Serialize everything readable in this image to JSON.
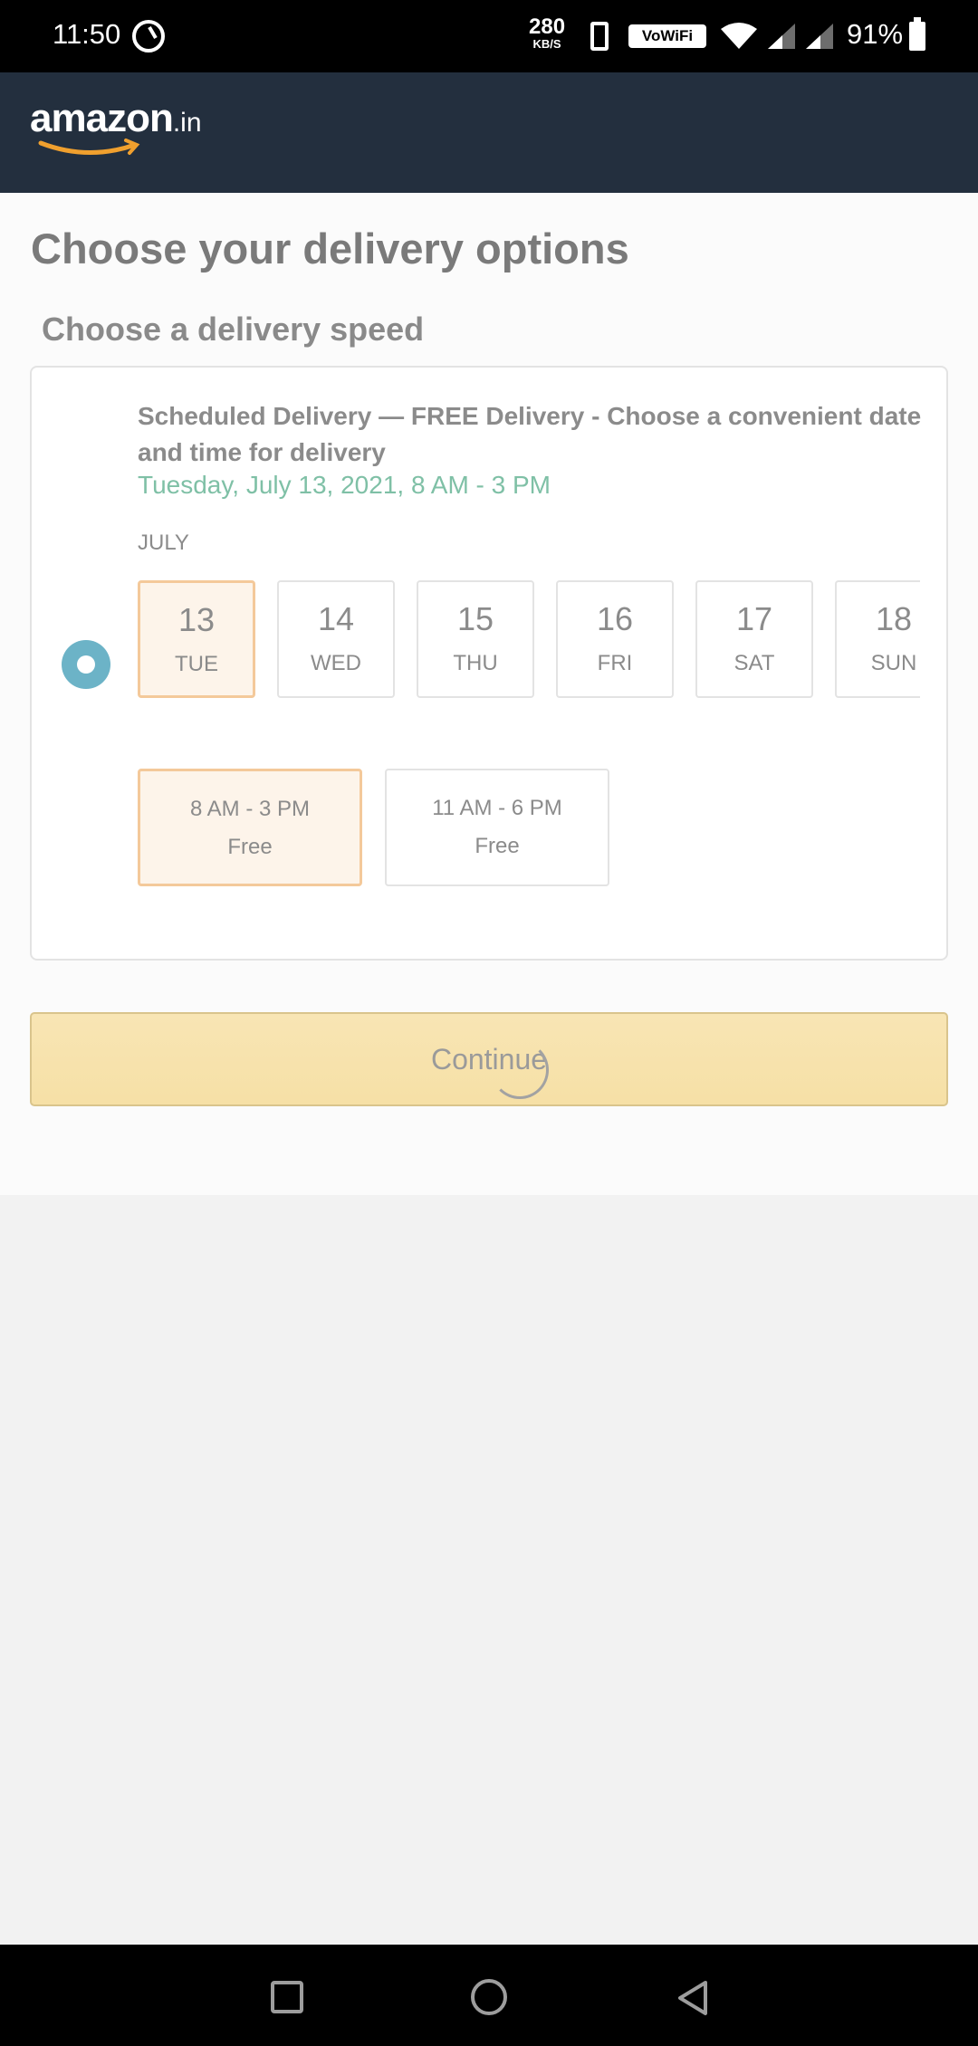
{
  "status_bar": {
    "time": "11:50",
    "speed_value": "280",
    "speed_unit": "KB/S",
    "vowifi": "VoWiFi",
    "battery": "91%"
  },
  "header": {
    "logo_main": "amazon",
    "logo_tld": ".in"
  },
  "page": {
    "title": "Choose your delivery options",
    "section_title": "Choose a delivery speed"
  },
  "option": {
    "title": "Scheduled Delivery — FREE Delivery - Choose a convenient date and time for delivery",
    "selected_date": "Tuesday, July 13, 2021, 8 AM - 3 PM",
    "month": "JULY",
    "dates": [
      {
        "num": "13",
        "day": "TUE",
        "selected": true
      },
      {
        "num": "14",
        "day": "WED",
        "selected": false
      },
      {
        "num": "15",
        "day": "THU",
        "selected": false
      },
      {
        "num": "16",
        "day": "FRI",
        "selected": false
      },
      {
        "num": "17",
        "day": "SAT",
        "selected": false
      },
      {
        "num": "18",
        "day": "SUN",
        "selected": false
      }
    ],
    "time_slots": [
      {
        "range": "8 AM - 3 PM",
        "price": "Free",
        "selected": true
      },
      {
        "range": "11 AM - 6 PM",
        "price": "Free",
        "selected": false
      }
    ]
  },
  "continue_label": "Continue",
  "colors": {
    "header_bg": "#232f3e",
    "accent_teal": "#6cb3c7",
    "date_green": "#7fc0a6",
    "selected_border": "#f4c99a",
    "selected_bg": "#fdf4ea",
    "button_yellow": "#f7e2ab",
    "smile_orange": "#f0a02e"
  }
}
